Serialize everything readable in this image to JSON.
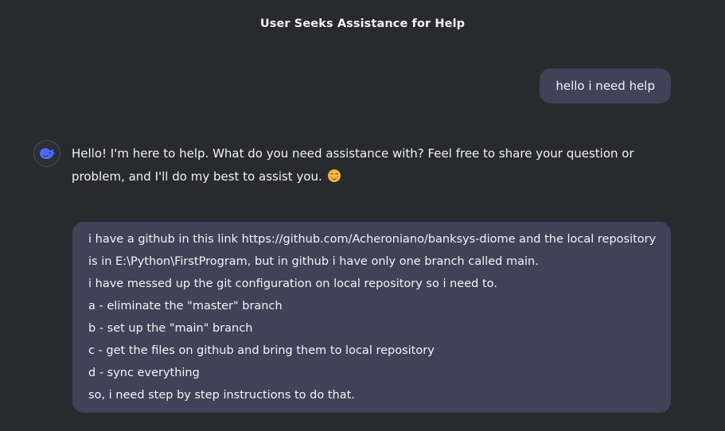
{
  "header": {
    "title": "User Seeks Assistance for Help"
  },
  "messages": {
    "user_1": "hello i need help",
    "assistant_1": {
      "text": "Hello! I'm here to help. What do you need assistance with? Feel free to share your question or problem, and I'll do my best to assist you.",
      "emoji_icon": "smiling-face-emoji-icon"
    },
    "user_2": {
      "lines": [
        "i have a github in this link https://github.com/Acheroniano/banksys-diome and the local repository",
        "is in E:\\Python\\FirstProgram, but in github i have only one branch called main.",
        "i have messed up the git configuration on local repository so i need to.",
        "a - eliminate the \"master\" branch",
        "b - set up the \"main\" branch",
        "c - get the files on github and bring them to local repository",
        "d - sync everything",
        "so, i need step by step instructions to do that."
      ]
    }
  },
  "assistant_avatar_icon": "whale-logo-icon",
  "colors": {
    "background": "#292a2d",
    "user_bubble": "#414158",
    "avatar_accent": "#4d6bfe"
  }
}
